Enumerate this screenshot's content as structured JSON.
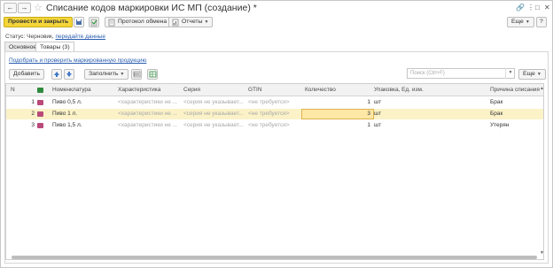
{
  "window": {
    "title": "Списание кодов маркировки ИС МП (создание) *",
    "back_glyph": "←",
    "forward_glyph": "→",
    "star_glyph": "☆",
    "controls": [
      "🔗",
      "⋮",
      "□",
      "✕"
    ]
  },
  "toolbar": {
    "post_close_label": "Провести и закрыть",
    "exchange_label": "Протокол обмена",
    "reports_label": "Отчеты",
    "more_label": "Еще",
    "help_label": "?"
  },
  "status": {
    "label": "Статус:",
    "value": "Черновик,",
    "link": "передайте данные"
  },
  "tabs": [
    "Основное",
    "Товары (3)"
  ],
  "pick_link": "Подобрать и проверить маркированную продукцию",
  "table_toolbar": {
    "add_label": "Добавить",
    "fill_label": "Заполнить",
    "search_placeholder": "Поиск (Ctrl+F)",
    "more_label": "Еще"
  },
  "table": {
    "columns": [
      "N",
      "Номенклатура",
      "Характеристика",
      "Серия",
      "GTIN",
      "Количество",
      "Упаковка, Ед. изм.",
      "Причина списания"
    ],
    "rows": [
      {
        "n": "1",
        "name": "Пиво 0,5 л.",
        "char": "<характеристики не ...",
        "series": "<серия не указывает...",
        "gtin": "<не требуется>",
        "qty": "1",
        "unit": "шт",
        "reason": "Брак"
      },
      {
        "n": "2",
        "name": "Пиво 1 л.",
        "char": "<характеристики не ...",
        "series": "<серия не указывает...",
        "gtin": "<не требуется>",
        "qty": "3",
        "unit": "шт",
        "reason": "Брак"
      },
      {
        "n": "3",
        "name": "Пиво 1,5 л.",
        "char": "<характеристики не ...",
        "series": "<серия не указывает...",
        "gtin": "<не требуется>",
        "qty": "1",
        "unit": "шт",
        "reason": "Утерян"
      }
    ]
  },
  "colors": {
    "primary": "#f4d63a",
    "selected_row": "#fbf2c8",
    "link": "#2a5db0"
  }
}
